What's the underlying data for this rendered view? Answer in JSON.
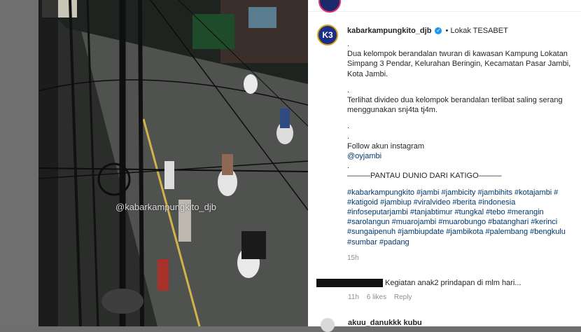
{
  "post": {
    "username": "kabarkampungkito_djb",
    "avatar_text": "K3",
    "location": "Lokak TESABET",
    "lines": [
      ".",
      "Dua kelompok berandalan twuran di kawasan Kampung Lokatan",
      "Simpang 3 Pendar, Kelurahan Beringin, Kecamatan Pasar Jambi,",
      "Kota Jambi.",
      ".",
      "Terlihat divideo dua kelompok berandalan terlibat saling serang",
      "menggunakan snj4ta tj4m.",
      ".",
      "."
    ],
    "follow_text": "Follow akun instagram",
    "mention": "@oyjambi",
    "dot_after_mention": ".",
    "banner": "———PANTAU DUNIO DARI KATIGO———",
    "hashtag_lines": [
      "#kabarkampungkito #jambi #jambicity #jambihits #kotajambi #",
      "#katigoid #jambiup #viralvideo #berita #indonesia",
      "#infoseputarjambi #tanjabtimur #tungkal #tebo #merangin",
      "#sarolangun #muarojambi #muarobungo #batanghari #kerinci",
      "#sungaipenuh #jambiupdate #jambikota #palembang #bengkulu",
      "#sumbar #padang"
    ],
    "time": "15h"
  },
  "comments": [
    {
      "text": "Kegiatan anak2 prindapan di mlm hari...",
      "time": "11h",
      "likes": "6 likes",
      "reply": "Reply"
    },
    {
      "username": "akuu_danukkk kubu"
    }
  ],
  "video": {
    "watermark": "@kabarkampungkito_djb"
  },
  "colors": {
    "link": "#00376b",
    "verified": "#1c96f0",
    "muted": "#8e8e8e"
  }
}
